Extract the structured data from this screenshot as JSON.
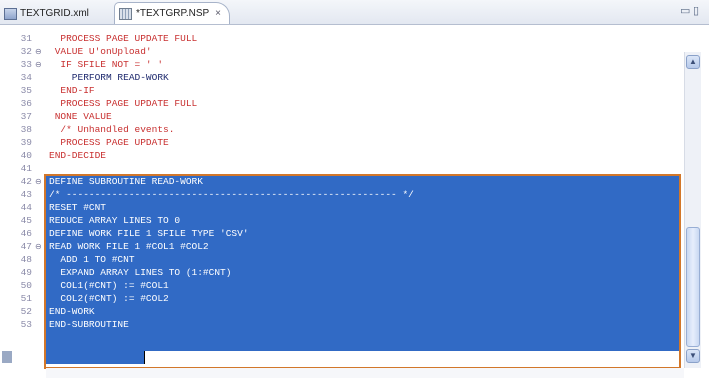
{
  "tabs": [
    {
      "label": "TEXTGRID.xml",
      "active": false
    },
    {
      "label": "*TEXTGRP.NSP",
      "active": true,
      "close_glyph": "×"
    }
  ],
  "window_controls": {
    "minimize": "▭",
    "maximize": "▯"
  },
  "lines": [
    {
      "n": "31",
      "text": "  PROCESS PAGE UPDATE FULL",
      "fold": "",
      "selected": false,
      "dark": false
    },
    {
      "n": "32",
      "text": " VALUE U'onUpload'",
      "fold": "⊖",
      "selected": false,
      "dark": false
    },
    {
      "n": "33",
      "text": "  IF SFILE NOT = ' '",
      "fold": "⊖",
      "selected": false,
      "dark": false
    },
    {
      "n": "34",
      "text": "    PERFORM READ-WORK",
      "fold": "",
      "selected": false,
      "dark": true
    },
    {
      "n": "35",
      "text": "  END-IF",
      "fold": "",
      "selected": false,
      "dark": false
    },
    {
      "n": "36",
      "text": "  PROCESS PAGE UPDATE FULL",
      "fold": "",
      "selected": false,
      "dark": false
    },
    {
      "n": "37",
      "text": " NONE VALUE",
      "fold": "",
      "selected": false,
      "dark": false
    },
    {
      "n": "38",
      "text": "  /* Unhandled events.",
      "fold": "",
      "selected": false,
      "dark": false
    },
    {
      "n": "39",
      "text": "  PROCESS PAGE UPDATE",
      "fold": "",
      "selected": false,
      "dark": false
    },
    {
      "n": "40",
      "text": "END-DECIDE",
      "fold": "",
      "selected": false,
      "dark": false
    },
    {
      "n": "41",
      "text": "/* ---------------------------------------------------------- */",
      "fold": "",
      "selected": true,
      "dark": false
    },
    {
      "n": "42",
      "text": "DEFINE SUBROUTINE READ-WORK",
      "fold": "⊖",
      "selected": true,
      "dark": false
    },
    {
      "n": "43",
      "text": "/* ---------------------------------------------------------- */",
      "fold": "",
      "selected": true,
      "dark": false
    },
    {
      "n": "44",
      "text": "RESET #CNT",
      "fold": "",
      "selected": true,
      "dark": false
    },
    {
      "n": "45",
      "text": "REDUCE ARRAY LINES TO 0",
      "fold": "",
      "selected": true,
      "dark": false
    },
    {
      "n": "46",
      "text": "DEFINE WORK FILE 1 SFILE TYPE 'CSV'",
      "fold": "",
      "selected": true,
      "dark": false
    },
    {
      "n": "47",
      "text": "READ WORK FILE 1 #COL1 #COL2",
      "fold": "⊖",
      "selected": true,
      "dark": false
    },
    {
      "n": "48",
      "text": "  ADD 1 TO #CNT",
      "fold": "",
      "selected": true,
      "dark": false
    },
    {
      "n": "49",
      "text": "  EXPAND ARRAY LINES TO (1:#CNT)",
      "fold": "",
      "selected": true,
      "dark": false
    },
    {
      "n": "50",
      "text": "  COL1(#CNT) := #COL1",
      "fold": "",
      "selected": true,
      "dark": false
    },
    {
      "n": "51",
      "text": "  COL2(#CNT) := #COL2",
      "fold": "",
      "selected": true,
      "dark": false
    },
    {
      "n": "52",
      "text": "END-WORK",
      "fold": "",
      "selected": true,
      "dark": false
    },
    {
      "n": "53",
      "text": "END-SUBROUTINE",
      "fold": "",
      "selected": true,
      "dark": false
    }
  ],
  "scroll": {
    "up": "▲",
    "down": "▼"
  },
  "colors": {
    "selection": "#316ac5",
    "highlight_frame": "#d2772a",
    "keyword": "#c83030"
  }
}
